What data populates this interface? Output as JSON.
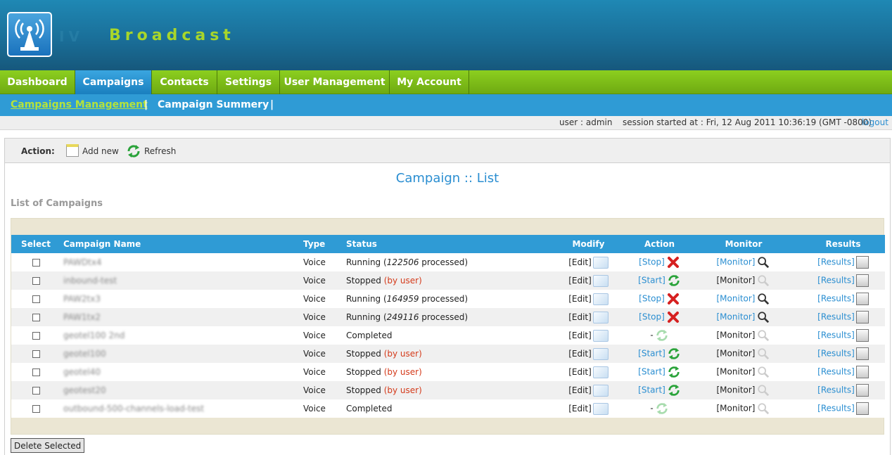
{
  "brand": {
    "name": "Broadcast",
    "ghost": "IV"
  },
  "nav": {
    "tabs": [
      {
        "label": "Dashboard"
      },
      {
        "label": "Campaigns"
      },
      {
        "label": "Contacts"
      },
      {
        "label": "Settings"
      },
      {
        "label": "User Management"
      },
      {
        "label": "My Account"
      }
    ],
    "active_tab": "Campaigns"
  },
  "subnav": {
    "items": [
      {
        "label": "Campaigns Management"
      },
      {
        "label": "Campaign Summery"
      }
    ],
    "separator": "|"
  },
  "infobar": {
    "user": "user : admin",
    "session": "session started at : Fri, 12 Aug 2011 10:36:19 (GMT -0800)",
    "logout": "logout"
  },
  "actionbar": {
    "label": "Action:",
    "add_new": "Add new",
    "refresh": "Refresh"
  },
  "page_title": "Campaign :: List",
  "list_title": "List of Campaigns",
  "table": {
    "headers": {
      "select": "Select",
      "name": "Campaign Name",
      "type": "Type",
      "status": "Status",
      "modify": "Modify",
      "action": "Action",
      "monitor": "Monitor",
      "results": "Results"
    },
    "rows": [
      {
        "name": "PAWDtx4",
        "type": "Voice",
        "status": "Running (",
        "processed": "122506",
        "status_tail": " processed)",
        "by_user": "",
        "edit": "[Edit]",
        "action": "[Stop]",
        "action_kind": "stop",
        "monitor": "[Monitor]",
        "monitor_active": true,
        "results": "[Results]"
      },
      {
        "name": "inbound-test",
        "type": "Voice",
        "status": "Stopped ",
        "processed": "",
        "status_tail": "",
        "by_user": "(by user)",
        "edit": "[Edit]",
        "action": "[Start]",
        "action_kind": "start",
        "monitor": "[Monitor]",
        "monitor_active": false,
        "results": "[Results]"
      },
      {
        "name": "PAW2tx3",
        "type": "Voice",
        "status": "Running (",
        "processed": "164959",
        "status_tail": " processed)",
        "by_user": "",
        "edit": "[Edit]",
        "action": "[Stop]",
        "action_kind": "stop",
        "monitor": "[Monitor]",
        "monitor_active": true,
        "results": "[Results]"
      },
      {
        "name": "PAW1tx2",
        "type": "Voice",
        "status": "Running (",
        "processed": "249116",
        "status_tail": " processed)",
        "by_user": "",
        "edit": "[Edit]",
        "action": "[Stop]",
        "action_kind": "stop",
        "monitor": "[Monitor]",
        "monitor_active": true,
        "results": "[Results]"
      },
      {
        "name": "geotel100 2nd",
        "type": "Voice",
        "status": "Completed",
        "processed": "",
        "status_tail": "",
        "by_user": "",
        "edit": "[Edit]",
        "action": "-",
        "action_kind": "none",
        "monitor": "[Monitor]",
        "monitor_active": false,
        "results": "[Results]"
      },
      {
        "name": "geotel100",
        "type": "Voice",
        "status": "Stopped ",
        "processed": "",
        "status_tail": "",
        "by_user": "(by user)",
        "edit": "[Edit]",
        "action": "[Start]",
        "action_kind": "start",
        "monitor": "[Monitor]",
        "monitor_active": false,
        "results": "[Results]"
      },
      {
        "name": "geotel40",
        "type": "Voice",
        "status": "Stopped ",
        "processed": "",
        "status_tail": "",
        "by_user": "(by user)",
        "edit": "[Edit]",
        "action": "[Start]",
        "action_kind": "start",
        "monitor": "[Monitor]",
        "monitor_active": false,
        "results": "[Results]"
      },
      {
        "name": "geotest20",
        "type": "Voice",
        "status": "Stopped ",
        "processed": "",
        "status_tail": "",
        "by_user": "(by user)",
        "edit": "[Edit]",
        "action": "[Start]",
        "action_kind": "start",
        "monitor": "[Monitor]",
        "monitor_active": false,
        "results": "[Results]"
      },
      {
        "name": "outbound-500-channels-load-test",
        "type": "Voice",
        "status": "Completed",
        "processed": "",
        "status_tail": "",
        "by_user": "",
        "edit": "[Edit]",
        "action": "-",
        "action_kind": "none",
        "monitor": "[Monitor]",
        "monitor_active": false,
        "results": "[Results]"
      }
    ]
  },
  "delete_button": "Delete Selected",
  "colors": {
    "header_blue": "#1a6f99",
    "nav_green": "#7cbd18",
    "accent_blue": "#2f9bd5",
    "brand_green": "#a8d62a",
    "link_blue": "#2a8ed1",
    "by_user_red": "#d43a1a"
  }
}
